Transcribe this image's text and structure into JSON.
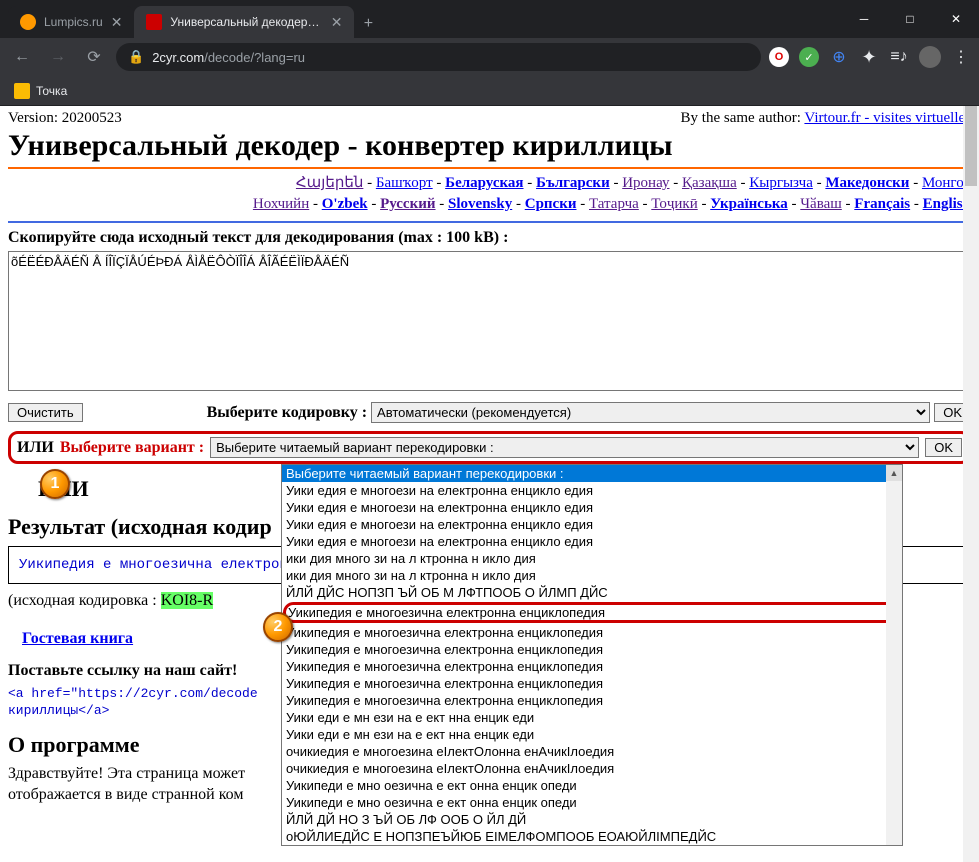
{
  "titlebar": {
    "tabs": [
      {
        "label": "Lumpics.ru",
        "favicon": "#ff9900"
      },
      {
        "label": "Универсальный декодер - конв",
        "favicon": "#cc0000"
      }
    ],
    "newtab": "+",
    "winmin": "─",
    "winmax": "□",
    "winclose": "✕"
  },
  "addrbar": {
    "back": "←",
    "fwd": "→",
    "reload": "⟳",
    "lock": "🔒",
    "domain": "2cyr.com",
    "path": "/decode/?lang=ru"
  },
  "bookmarks": {
    "item1": "Точка"
  },
  "version_row": {
    "version": "Version: 20200523",
    "by_author": "By the same author: ",
    "author_link": "Virtour.fr - visites virtuelles"
  },
  "h1": "Универсальный декодер - конвертер кириллицы",
  "langs": {
    "l1": "Հայերեն",
    "l2": "Башҡорт",
    "l3": "Беларуская",
    "l4": "Български",
    "l5": "Иронау",
    "l6": "Қазақша",
    "l7": "Кыргызча",
    "l8": "Македонски",
    "l9": "Монгол",
    "l10": "Нохчийн",
    "l11": "O'zbek",
    "l12": "Русский",
    "l13": "Slovensky",
    "l14": "Српски",
    "l15": "Татарча",
    "l16": "Тоҷикӣ",
    "l17": "Українська",
    "l18": "Чӑваш",
    "l19": "Français",
    "l20": "English"
  },
  "prompt1": "Скопируйте сюда исходный текст для декодирования (max : 100 kB) :",
  "src_text": "õÉËÉÐÅÄÉÑ Å ÍÎÏÇÏÅÚÉÞÐÁ ÅÌÅËÔÒÏÎÎÁ ÅÎÃÉËÌÏÐÅÄÉÑ",
  "clear_btn": "Очистить",
  "enc_label": "Выберите кодировку :",
  "enc_value": "Автоматически (рекомендуется)",
  "ok": "OK",
  "or_label": "ИЛИ",
  "variant_label": "Выберите вариант :",
  "variant_value": "Выберите читаемый вариант перекодировки :",
  "or_h2": "ИЛИ",
  "result_h2": "Результат (исходная кодир",
  "result_text": "Уикипедия е многоезична електрон",
  "srccoding_pre": "(исходная кодировка : ",
  "srccoding_val": "KOI8-R",
  "guest_link": "Гостевая книга",
  "promo_label": "Поставьте ссылку на наш сайт!",
  "code_line1": "<a href=\"https://2cyr.com/decode",
  "code_line2": "кириллицы</a>",
  "about_h2": "О программе",
  "body1": "Здравствуйте! Эта страница может",
  "body2": "отображается в виде странной ком",
  "dropdown": {
    "o0": "Выберите читаемый вариант перекодировки :",
    "o1": "Уики едия е многоези на електронна енцикло едия",
    "o2": "Уики едия е многоези на електронна енцикло едия",
    "o3": "Уики едия е многоези на електронна енцикло едия",
    "o4": "Уики едия е многоези на електронна енцикло едия",
    "o5": "ики дия много зи на л ктронна н икло дия",
    "o6": "ики дия много зи на л ктронна н икло дия",
    "o7": "ЙЛЙ ДЙС НОПЗП ЪЙ ОБ М ЛФТПООБ О ЙЛМП ДЙС",
    "o8": "Уикипедия е многоезична електронна енциклопедия",
    "o9": "Уикипедия е многоезична електронна енциклопедия",
    "o10": "Уикипедия е многоезична електронна енциклопедия",
    "o11": "Уикипедия е многоезична електронна енциклопедия",
    "o12": "Уикипедия е многоезична електронна енциклопедия",
    "o13": "Уикипедия е многоезична електронна енциклопедия",
    "o14": "Уики еди е мн ези на е ект нна енцик еди",
    "o15": "Уики еди е мн ези на е ект нна енцик еди",
    "o16": "очикиедия е многоезина еІлектОлонна енАчикІлоедия",
    "o17": "очикиедия е многоезина еІлектОлонна енАчикІлоедия",
    "o18": "Уикипеди е мно оезична е ект онна енцик опеди",
    "o19": "Уикипеди е мно оезична е ект онна енцик опеди",
    "o20": "ЙЛЙ ДЙ НО З ЪЙ ОБ ЛФ ООБ О ЙЛ ДЙ",
    "o21": "оЮЙЛИЕДЙС Е НОПЗПЕЪЙЮБ ЕІМЕЛФОМПООБ ЕОАЮЙЛІМПЕДЙС"
  }
}
